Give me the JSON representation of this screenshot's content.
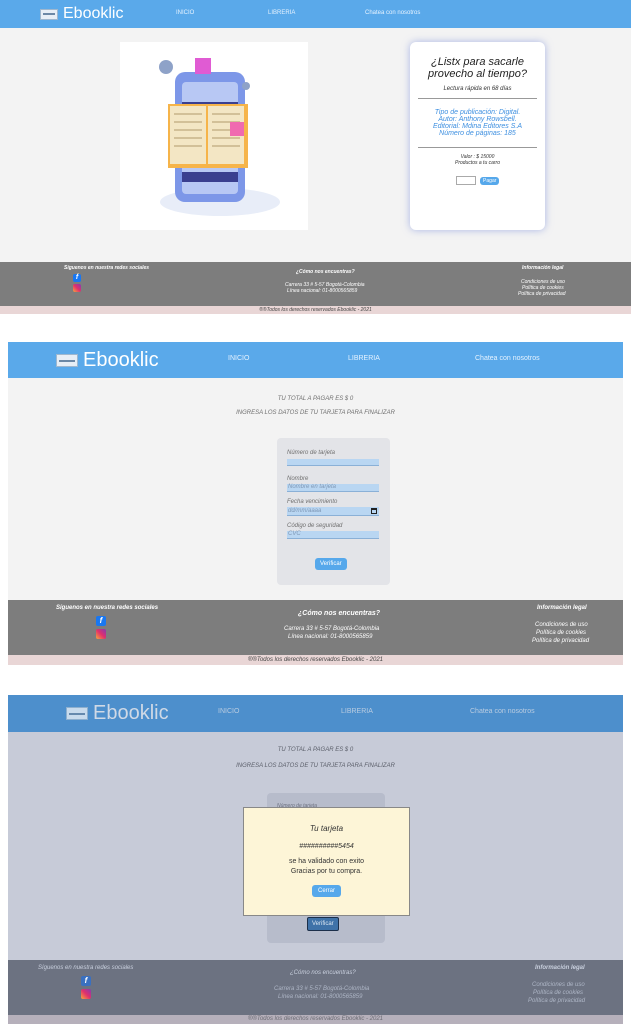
{
  "brand": {
    "name": "Ebooklic"
  },
  "nav": {
    "inicio": "INICIO",
    "libreria": "LIBRERIA",
    "chat": "Chatea con nosotros"
  },
  "product": {
    "title": "¿Listx para sacarle provecho al tiempo?",
    "subtitle": "Lectura rápida en 68 días",
    "type": "Tipo de publicación: Digital.",
    "author": "Autor: Anthony Rowsbell.",
    "publisher": "Editorial: Mdina Editores S.A",
    "pages": "Número de páginas: 185",
    "price": "Valor : $ 15000",
    "cart_note": "Productos a tu carro",
    "pay_label": "Pagar"
  },
  "footer": {
    "social_title": "Síguenos en nuestra redes sociales",
    "find_title": "¿Cómo nos encuentras?",
    "address": "Carrera 33 # 5-57 Bogotá-Colombia",
    "phone": "Línea nacional: 01-8000565859",
    "legal_title": "Información legal",
    "legal1": "Condiciones de uso",
    "legal2": "Política de cookies",
    "legal3": "Política de privacidad",
    "copyright": "®®Todos los derechos reservados Ebooklic - 2021"
  },
  "payment": {
    "total": "TU TOTAL A PAGAR ES $ 0",
    "instructions": "INGRESA LOS DATOS DE TU TARJETA PARA FINALIZAR",
    "card_label": "Número de tarjeta",
    "name_label": "Nombre",
    "name_placeholder": "Nombre en tarjeta",
    "date_label": "Fecha vencimiento",
    "date_placeholder": "dd/mm/aaaa",
    "cvc_label": "Código de seguridad",
    "cvc_placeholder": "CVC",
    "verify": "Verificar"
  },
  "modal": {
    "title": "Tu tarjeta",
    "card": "##########5454",
    "line1": "se ha validado con exito",
    "line2": "Gracias por tu compra.",
    "close": "Cerrar",
    "partial_label": "Número de tarjeta"
  }
}
